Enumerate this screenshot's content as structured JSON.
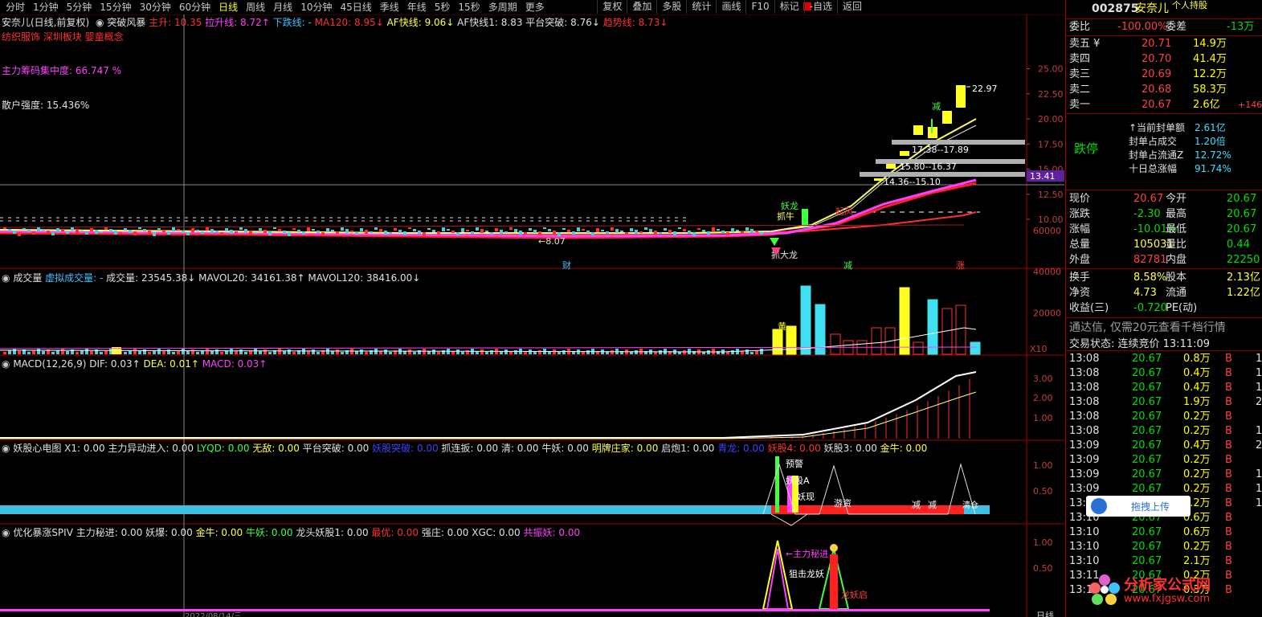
{
  "toolbar": {
    "periods": [
      "分时",
      "1分钟",
      "5分钟",
      "15分钟",
      "30分钟",
      "60分钟",
      "日线",
      "周线",
      "月线",
      "10分钟",
      "45日线",
      "季线",
      "年线",
      "5秒",
      "15秒",
      "多周期",
      "更多"
    ],
    "active_period": "日线",
    "buttons": [
      "复权",
      "叠加",
      "多股",
      "统计",
      "画线",
      "F10",
      "标记",
      "-自选",
      "返回"
    ]
  },
  "main": {
    "title": "安奈儿(日线,前复权)",
    "indicator": "突破风暴",
    "params": [
      {
        "label": "主升: 10.35",
        "color": "#ff3030"
      },
      {
        "label": "拉升线: 8.72↑",
        "color": "#ff40ff"
      },
      {
        "label": "下跌线: -",
        "color": "#40c0ff"
      },
      {
        "label": "MA120: 8.95↓",
        "color": "#ff3030"
      },
      {
        "label": "AF快线: 9.06↓",
        "color": "#ffff40"
      },
      {
        "label": "AF快线1: 8.83",
        "color": "#e0e0e0"
      },
      {
        "label": "平台突破: 8.76↓",
        "color": "#e0e0e0"
      },
      {
        "label": "趋势线: 8.73↓",
        "color": "#ff3030"
      }
    ],
    "sectors": "纺织服饰 深圳板块 婴童概念",
    "concentration": "主力筹码集中度: 66.747  %",
    "retail": "散户强度: 15.436%",
    "price_ticks": [
      "25.00",
      "22.50",
      "20.00",
      "17.50",
      "15.00",
      "12.50",
      "10.00"
    ],
    "labels": {
      "high": "22.97",
      "band1": "17.38--17.89",
      "band2": "15.80--16.37",
      "band3": "14.36--15.10",
      "low": "8.07",
      "current": "13.41",
      "yaoxian": "妖龙",
      "zhua": "抓牛",
      "dalong": "抓大龙",
      "qiqi": "起风",
      "jian": "减",
      "cai": "财",
      "jian2": "减",
      "zhang": "涨"
    }
  },
  "volume": {
    "title": "成交量",
    "params": [
      {
        "label": "虚拟成交量: -",
        "color": "#40c0ff"
      },
      {
        "label": "成交量: 23545.38↓",
        "color": "#e0e0e0"
      },
      {
        "label": "MAVOL20: 34161.38↑",
        "color": "#e0e0e0"
      },
      {
        "label": "MAVOL120: 38416.00↓",
        "color": "#e0e0e0"
      }
    ],
    "ticks": [
      "60000",
      "40000",
      "20000"
    ],
    "unit": "X10",
    "mark": "黄"
  },
  "macd": {
    "title": "MACD(12,26,9)",
    "params": [
      {
        "label": "DIF: 0.03↑",
        "color": "#e0e0e0"
      },
      {
        "label": "DEA: 0.01↑",
        "color": "#ffff40"
      },
      {
        "label": "MACD: 0.03↑",
        "color": "#ff40ff"
      }
    ],
    "ticks": [
      "3.00",
      "2.00",
      "1.00"
    ]
  },
  "yaogu": {
    "title": "妖股心电图",
    "params": [
      {
        "label": "X1: 0.00",
        "color": "#e0e0e0"
      },
      {
        "label": "主力异动进入: 0.00",
        "color": "#e0e0e0"
      },
      {
        "label": "LYQD: 0.00",
        "color": "#40ff40"
      },
      {
        "label": "无敌: 0.00",
        "color": "#ffff40"
      },
      {
        "label": "平台突破: 0.00",
        "color": "#e0e0e0"
      },
      {
        "label": "妖股突破: 0.00",
        "color": "#4040ff"
      },
      {
        "label": "抓连扳: 0.00",
        "color": "#e0e0e0"
      },
      {
        "label": "清: 0.00",
        "color": "#e0e0e0"
      },
      {
        "label": "牛妖: 0.00",
        "color": "#e0e0e0"
      },
      {
        "label": "明牌庄家: 0.00",
        "color": "#ffff40"
      },
      {
        "label": "启炮1: 0.00",
        "color": "#e0e0e0"
      },
      {
        "label": "青龙: 0.00",
        "color": "#4040ff"
      },
      {
        "label": "妖股4: 0.00",
        "color": "#ff3030"
      },
      {
        "label": "妖股3: 0.00",
        "color": "#e0e0e0"
      },
      {
        "label": "金牛: 0.00",
        "color": "#ffff40"
      }
    ],
    "ticks": [
      "1.00",
      "0.50"
    ],
    "labels": {
      "warn": "预警",
      "a": "妖股A",
      "show": "妖现",
      "zi": "游资",
      "j1": "减",
      "j2": "减",
      "qing": "清仓"
    }
  },
  "spiv": {
    "title": "优化暴涨SPIV",
    "params": [
      {
        "label": "主力秘进: 0.00",
        "color": "#e0e0e0"
      },
      {
        "label": "妖爆: 0.00",
        "color": "#e0e0e0"
      },
      {
        "label": "金牛: 0.00",
        "color": "#ffff40"
      },
      {
        "label": "牛妖: 0.00",
        "color": "#40ff40"
      },
      {
        "label": "龙头妖股1: 0.00",
        "color": "#e0e0e0"
      },
      {
        "label": "最优: 0.00",
        "color": "#ff3030"
      },
      {
        "label": "强庄: 0.00",
        "color": "#e0e0e0"
      },
      {
        "label": "XGC: 0.00",
        "color": "#e0e0e0"
      },
      {
        "label": "共振妖: 0.00",
        "color": "#ff40ff"
      }
    ],
    "ticks": [
      "1.00",
      "0.50"
    ],
    "labels": {
      "mj": "主力秘进",
      "zj": "狙击龙妖",
      "lyq": "龙妖启"
    }
  },
  "bottom": {
    "date": "2022/08/14/三",
    "period": "日线"
  },
  "quote": {
    "code": "002875",
    "name": "安奈儿",
    "tag": "个人持股",
    "weibi_label": "委比",
    "weibi": "-100.00%",
    "weicha_label": "委差",
    "weicha": "-13万",
    "asks": [
      {
        "label": "卖五",
        "price": "20.71",
        "vol": "14.9万"
      },
      {
        "label": "卖四",
        "price": "20.70",
        "vol": "41.4万"
      },
      {
        "label": "卖三",
        "price": "20.69",
        "vol": "12.2万"
      },
      {
        "label": "卖二",
        "price": "20.68",
        "vol": "58.3万"
      },
      {
        "label": "卖一",
        "price": "20.67",
        "vol": "2.6亿",
        "extra": "+146"
      }
    ],
    "limit_status": "跌停",
    "limit_info": [
      {
        "label": "当前封单额",
        "value": "2.61亿"
      },
      {
        "label": "封单占成交",
        "value": "1.20倍"
      },
      {
        "label": "封单占流通Z",
        "value": "12.72%"
      },
      {
        "label": "十日总涨幅",
        "value": "91.74%"
      }
    ],
    "stats": [
      {
        "l1": "现价",
        "v1": "20.67",
        "l2": "今开",
        "v2": "20.67"
      },
      {
        "l1": "涨跌",
        "v1": "-2.30",
        "l2": "最高",
        "v2": "20.67"
      },
      {
        "l1": "涨幅",
        "v1": "-10.01%",
        "l2": "最低",
        "v2": "20.67"
      },
      {
        "l1": "总量",
        "v1": "105031",
        "l2": "量比",
        "v2": "0.44"
      },
      {
        "l1": "外盘",
        "v1": "82781",
        "l2": "内盘",
        "v2": "22250"
      }
    ],
    "stats2": [
      {
        "l1": "换手",
        "v1": "8.58%",
        "l2": "股本",
        "v2": "2.13亿"
      },
      {
        "l1": "净资",
        "v1": "4.73",
        "l2": "流通",
        "v2": "1.22亿"
      },
      {
        "l1": "收益(三)",
        "v1": "-0.720",
        "l2": "PE(动)",
        "v2": ""
      }
    ],
    "notice": "通达信, 仅需20元查看千档行情",
    "trade_state": "交易状态: 连续竞价 13:11:09",
    "ticks": [
      {
        "t": "13:08",
        "p": "20.67",
        "v": "0.8万",
        "bs": "B",
        "n": "1"
      },
      {
        "t": "13:08",
        "p": "20.67",
        "v": "0.4万",
        "bs": "B",
        "n": "1"
      },
      {
        "t": "13:08",
        "p": "20.67",
        "v": "0.4万",
        "bs": "B",
        "n": "1"
      },
      {
        "t": "13:08",
        "p": "20.67",
        "v": "1.9万",
        "bs": "B",
        "n": "2"
      },
      {
        "t": "13:08",
        "p": "20.67",
        "v": "0.2万",
        "bs": "B",
        "n": ""
      },
      {
        "t": "13:08",
        "p": "20.67",
        "v": "0.2万",
        "bs": "B",
        "n": "1"
      },
      {
        "t": "13:09",
        "p": "20.67",
        "v": "0.4万",
        "bs": "B",
        "n": "2"
      },
      {
        "t": "13:09",
        "p": "20.67",
        "v": "0.2万",
        "bs": "B",
        "n": ""
      },
      {
        "t": "13:09",
        "p": "20.67",
        "v": "0.2万",
        "bs": "B",
        "n": "1"
      },
      {
        "t": "13:09",
        "p": "20.67",
        "v": "0.2万",
        "bs": "B",
        "n": "1"
      },
      {
        "t": "13:09",
        "p": "20.67",
        "v": "0.2万",
        "bs": "B",
        "n": "1"
      },
      {
        "t": "13:10",
        "p": "20.67",
        "v": "0.6万",
        "bs": "B",
        "n": ""
      },
      {
        "t": "13:10",
        "p": "20.67",
        "v": "0.6万",
        "bs": "B",
        "n": ""
      },
      {
        "t": "13:10",
        "p": "20.67",
        "v": "0.2万",
        "bs": "B",
        "n": ""
      },
      {
        "t": "13:10",
        "p": "20.67",
        "v": "2.1万",
        "bs": "B",
        "n": ""
      },
      {
        "t": "13:11",
        "p": "20.67",
        "v": "0.2万",
        "bs": "B",
        "n": ""
      },
      {
        "t": "13:11",
        "p": "20.67",
        "v": "0.3万",
        "bs": "B",
        "n": ""
      }
    ],
    "drag_button": "拖拽上传",
    "logo_text": "分析家公式网",
    "logo_url": "www.fxjgsw.com"
  }
}
